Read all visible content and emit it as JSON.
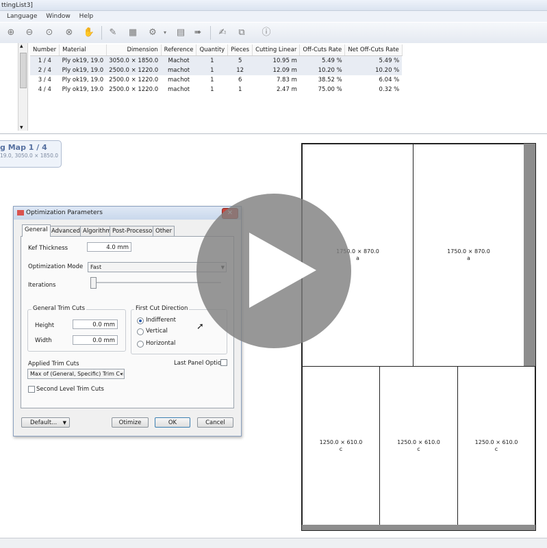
{
  "window": {
    "title": "ttingList3]"
  },
  "menu": {
    "items": [
      "Language",
      "Window",
      "Help"
    ]
  },
  "toolbar": {
    "icons": [
      "zoom-in-icon",
      "zoom-out-icon",
      "zoom-fit-icon",
      "zoom-window-icon",
      "pan-hand-icon",
      "edit-icon",
      "cut-layout-icon",
      "settings-icon",
      "report-icon",
      "export-icon",
      "sign-icon",
      "stack-icon",
      "info-icon"
    ]
  },
  "table": {
    "headers": [
      "Number",
      "Material",
      "Dimension",
      "Reference",
      "Quantity",
      "Pieces",
      "Cutting Linear",
      "Off-Cuts Rate",
      "Net Off-Cuts Rate"
    ],
    "rows": [
      [
        "1 / 4",
        "Ply ok19, 19.0",
        "3050.0 × 1850.0",
        "Machot",
        "1",
        "5",
        "10.95  m",
        "5.49 %",
        "5.49 %"
      ],
      [
        "2 / 4",
        "Ply ok19, 19.0",
        "2500.0 × 1220.0",
        "machot",
        "1",
        "12",
        "12.09  m",
        "10.20 %",
        "10.20 %"
      ],
      [
        "3 / 4",
        "Ply ok19, 19.0",
        "2500.0 × 1220.0",
        "machot",
        "1",
        "6",
        "7.83  m",
        "38.52 %",
        "6.04 %"
      ],
      [
        "4 / 4",
        "Ply ok19, 19.0",
        "2500.0 × 1220.0",
        "machot",
        "1",
        "1",
        "2.47  m",
        "75.00 %",
        "0.32 %"
      ]
    ]
  },
  "map": {
    "title": "g Map 1 / 4",
    "subtitle": "19.0, 3050.0 × 1850.0"
  },
  "pieces": [
    {
      "dim": "1750.0 × 870.0",
      "ref": "a"
    },
    {
      "dim": "1750.0 × 870.0",
      "ref": "a"
    },
    {
      "dim": "1250.0 × 610.0",
      "ref": "c"
    },
    {
      "dim": "1250.0 × 610.0",
      "ref": "c"
    },
    {
      "dim": "1250.0 × 610.0",
      "ref": "c"
    }
  ],
  "dialog": {
    "title": "Optimization Parameters",
    "close": "✕",
    "tabs": [
      "General",
      "Advanced",
      "Algorithm",
      "Post-Processor",
      "Other"
    ],
    "kerf_label": "Kef Thickness",
    "kerf_value": "4.0 mm",
    "mode_label": "Optimization Mode",
    "mode_value": "Fast",
    "iter_label": "Iterations",
    "trim_group": "General Trim Cuts",
    "height_label": "Height",
    "height_value": "0.0 mm",
    "width_label": "Width",
    "width_value": "0.0 mm",
    "dir_group": "First Cut Direction",
    "dir_options": [
      "Indifferent",
      "Vertical",
      "Horizontal"
    ],
    "applied_label": "Applied Trim Cuts",
    "applied_value": "Max of (General, Specific) Trim Cu",
    "last_panel": "Last Panel Option",
    "second_level": "Second Level Trim Cuts",
    "btn_default": "Default...",
    "btn_optimize": "Otimize",
    "btn_ok": "OK",
    "btn_cancel": "Cancel"
  }
}
